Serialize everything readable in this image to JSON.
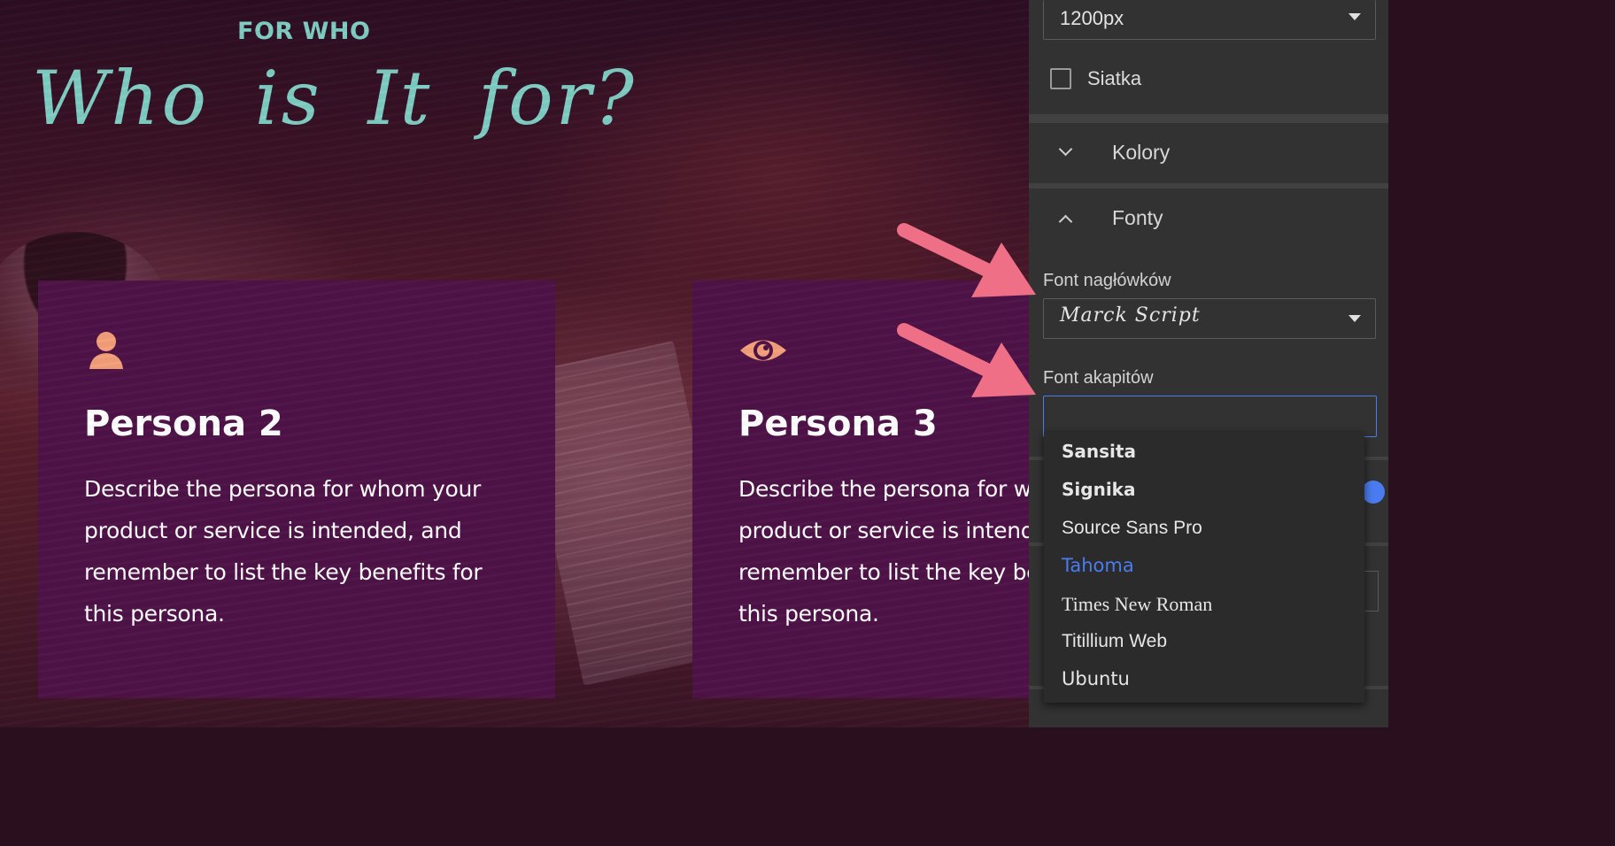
{
  "canvas": {
    "kicker": "FOR WHO",
    "title": "Who is It for?",
    "cards": [
      {
        "icon": "person-icon",
        "title": "Persona 2",
        "body": "Describe the persona for whom your product or service is intended, and remember to list the key benefits for this persona."
      },
      {
        "icon": "eye-icon",
        "title": "Persona 3",
        "body": "Describe the persona for whom your product or service is intended, and remember to list the key benefits for this persona."
      }
    ],
    "colors": {
      "accent_teal": "#7fcdc4",
      "card_bg": "#4e1347",
      "icon_peach": "#f4a07a"
    }
  },
  "panel": {
    "width_select": {
      "value": "1200px"
    },
    "grid_checkbox": {
      "label": "Siatka",
      "checked": false
    },
    "sections": [
      {
        "label": "Kolory",
        "expanded": false
      },
      {
        "label": "Fonty",
        "expanded": true
      }
    ],
    "heading_font": {
      "label": "Font nagłówków",
      "value": "Marck Script"
    },
    "paragraph_font": {
      "label": "Font akapitów",
      "value": ""
    },
    "font_options": [
      {
        "label": "Sansita",
        "selected": false
      },
      {
        "label": "Signika",
        "selected": false
      },
      {
        "label": "Source Sans Pro",
        "selected": false
      },
      {
        "label": "Tahoma",
        "selected": true
      },
      {
        "label": "Times New Roman",
        "selected": false
      },
      {
        "label": "Titillium Web",
        "selected": false
      },
      {
        "label": "Ubuntu",
        "selected": false
      }
    ],
    "colors": {
      "panel_bg": "#323232",
      "focus_blue": "#4a7cf0",
      "annotation_arrow": "#ee6f86"
    }
  }
}
